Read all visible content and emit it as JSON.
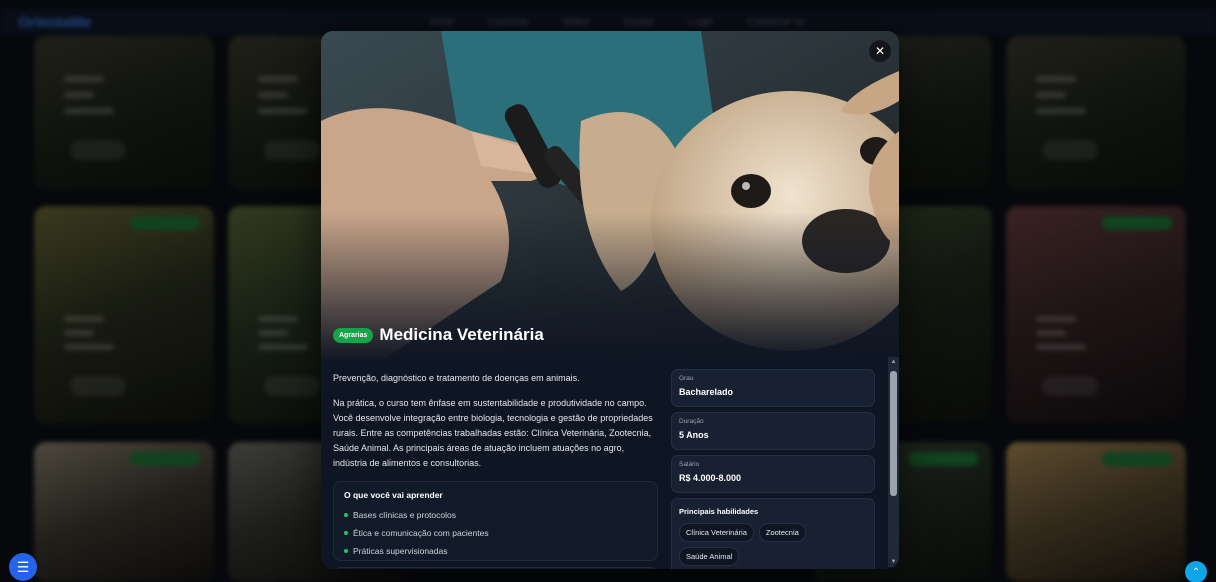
{
  "background": {
    "logo": "OrientaMe",
    "nav_links": [
      "Início",
      "Carreiras",
      "Sobre",
      "Equipe",
      "Login",
      "Cadastrar-se"
    ]
  },
  "modal": {
    "close_icon": "close-icon",
    "category_badge": "Agrarias",
    "title": "Medicina Veterinária",
    "description": "Prevenção, diagnóstico e tratamento de doenças em animais.",
    "details": "Na prática, o curso tem ênfase em sustentabilidade e produtividade no campo. Você desenvolve integração entre biologia, tecnologia e gestão de propriedades rurais. Entre as competências trabalhadas estão: Clínica Veterinária, Zootecnia, Saúde Animal. As principais áreas de atuação incluem atuações no agro, indústria de alimentos e consultorias.",
    "learn": {
      "title": "O que você vai aprender",
      "items": [
        "Bases clínicas e protocolos",
        "Ética e comunicação com pacientes",
        "Práticas supervisionadas"
      ]
    },
    "info": [
      {
        "label": "Grau",
        "value": "Bacharelado"
      },
      {
        "label": "Duração",
        "value": "5 Anos"
      },
      {
        "label": "Salário",
        "value": "R$ 4.000-8.000"
      }
    ],
    "skills": {
      "title": "Principais habilidades",
      "chips": [
        "Clínica Veterinária",
        "Zootecnia",
        "Saúde Animal"
      ]
    }
  },
  "fab": {
    "menu_icon": "menu-icon",
    "top_icon": "chevron-up-icon"
  },
  "colors": {
    "accent": "#2563eb",
    "badge": "#16a34a",
    "modal_bg": "#0f1623"
  }
}
